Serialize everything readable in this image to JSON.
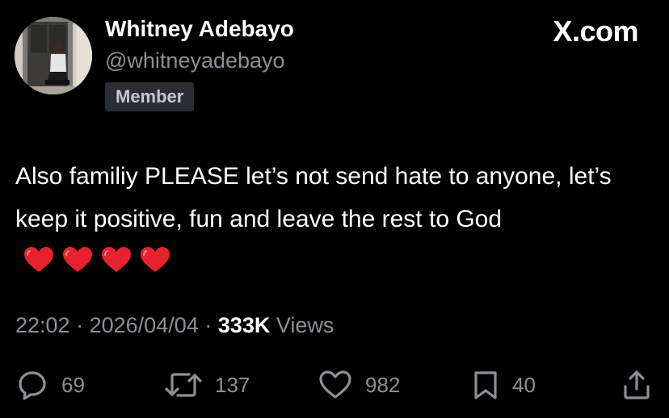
{
  "header": {
    "display_name": "Whitney Adebayo",
    "handle": "@whitneyadebayo",
    "badge": "Member",
    "brand": "X.com",
    "avatar_icon": "profile-photo"
  },
  "tweet": {
    "text": "Also familiy PLEASE let’s not send hate to anyone, let’s keep it positive, fun and leave the rest to God",
    "emoji": [
      "heart-emoji",
      "heart-emoji",
      "heart-emoji",
      "heart-emoji"
    ],
    "time": "22:02",
    "date": "2026/04/04",
    "separator": "·",
    "views_count": "333K",
    "views_label": "Views"
  },
  "actions": {
    "replies": "69",
    "retweets": "137",
    "likes": "982",
    "bookmarks": "40",
    "icons": [
      "reply-icon",
      "retweet-icon",
      "like-icon",
      "bookmark-icon",
      "share-icon"
    ]
  },
  "colors": {
    "background": "#000000",
    "primary_text": "#ffffff",
    "secondary_text": "#8b9096",
    "badge_bg": "#2a2d31",
    "heart": "#e8212f"
  }
}
